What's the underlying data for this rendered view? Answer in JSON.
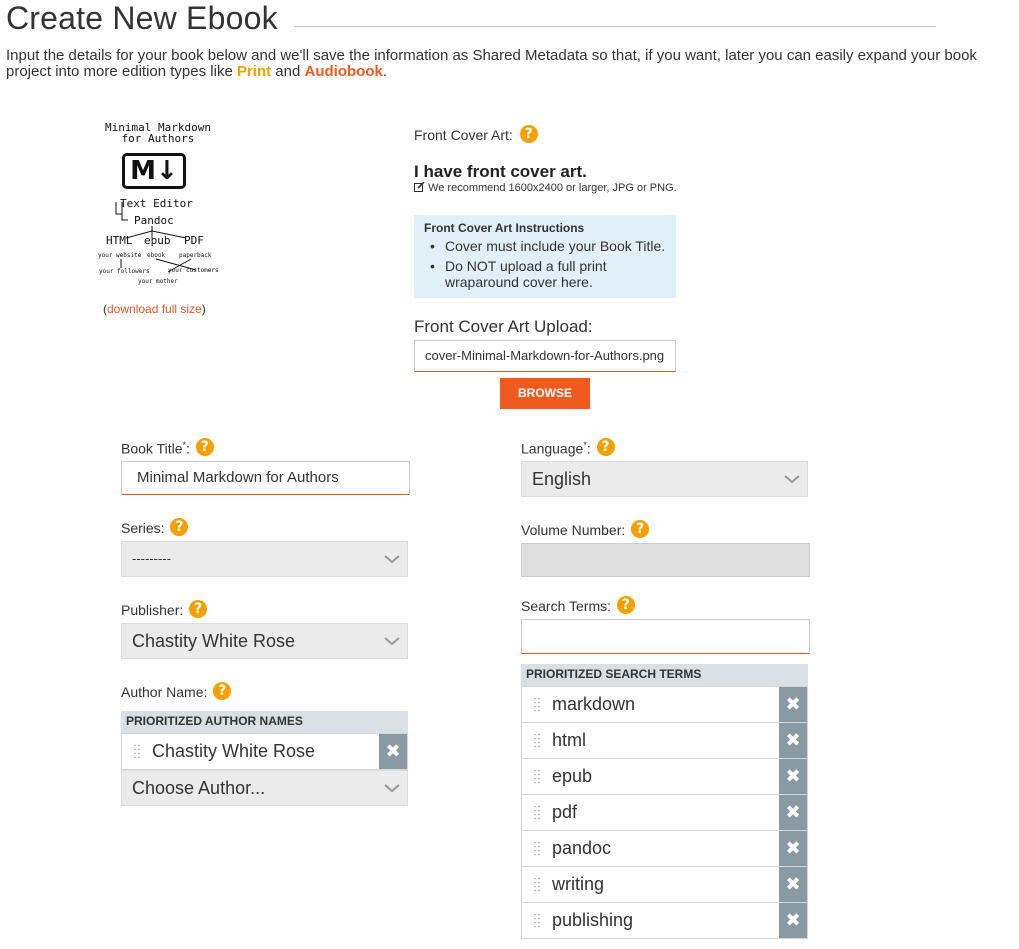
{
  "page": {
    "title": "Create New Ebook",
    "intro_text": "Input the details for your book below and we'll save the information as Shared Metadata so that, if you want, later you can easily expand your book project into more edition types like ",
    "intro_print": "Print",
    "intro_and": " and ",
    "intro_audiobook": "Audiobook",
    "intro_end": "."
  },
  "cover_image": {
    "title_line1": "Minimal Markdown",
    "title_line2": "for Authors",
    "logo": "M↓",
    "text_editor": "Text Editor",
    "pandoc": "Pandoc",
    "html": "HTML",
    "epub": "epub",
    "pdf": "PDF",
    "your_website": "your website",
    "ebook": "ebook",
    "paperback": "paperback",
    "your_followers": "your followers",
    "your_customers": "your customers",
    "your_mother": "your mother",
    "dl_open": "(",
    "download_link": "download full size",
    "dl_close": ")"
  },
  "front_cover": {
    "label": "Front Cover Art:",
    "have_art": "I have front cover art.",
    "recommend": "We recommend 1600x2400 or larger, JPG or PNG.",
    "instructions_title": "Front Cover Art Instructions",
    "instructions": [
      "Cover must include your Book Title.",
      "Do NOT upload a full print wraparound cover here."
    ],
    "upload_label": "Front Cover Art Upload:",
    "upload_value": "cover-Minimal-Markdown-for-Authors.png",
    "browse_label": "BROWSE"
  },
  "form": {
    "book_title_label": "Book Title",
    "book_title_value": "Minimal Markdown for Authors",
    "series_label": "Series:",
    "series_value": "---------",
    "publisher_label": "Publisher:",
    "publisher_value": "Chastity White Rose",
    "author_label": "Author Name:",
    "author_header": "PRIORITIZED AUTHOR NAMES",
    "authors": [
      "Chastity White Rose"
    ],
    "author_choose": "Choose Author...",
    "language_label": "Language",
    "language_value": "English",
    "volume_label": "Volume Number:",
    "search_label": "Search Terms:",
    "search_value": "",
    "search_header": "PRIORITIZED SEARCH TERMS",
    "search_terms": [
      "markdown",
      "html",
      "epub",
      "pdf",
      "pandoc",
      "writing",
      "publishing"
    ],
    "required_mark": "*",
    "colon": ":",
    "help_glyph": "?",
    "remove_glyph": "✖"
  },
  "icons": {
    "help": "question-circle-icon",
    "edit": "edit-icon",
    "chevron": "chevron-down-icon",
    "drag": "drag-handle-icon",
    "remove": "remove-icon"
  },
  "colors": {
    "accent_orange": "#f05a1e",
    "help_orange": "#f5a000",
    "print_orange": "#f5a000",
    "info_bg": "#e0eff8",
    "remove_bg": "#8a9aa5"
  }
}
